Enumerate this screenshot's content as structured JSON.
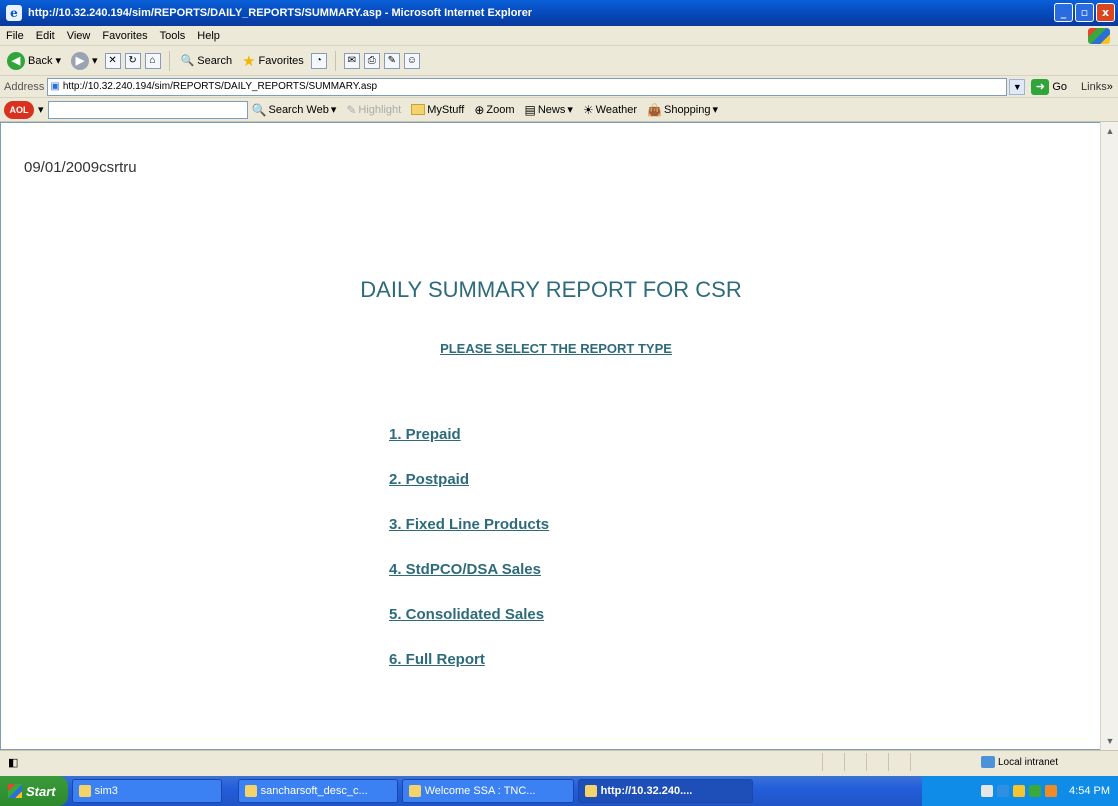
{
  "window": {
    "title": "http://10.32.240.194/sim/REPORTS/DAILY_REPORTS/SUMMARY.asp - Microsoft Internet Explorer",
    "minimize": "_",
    "maximize": "▫",
    "close": "x"
  },
  "menu": [
    "File",
    "Edit",
    "View",
    "Favorites",
    "Tools",
    "Help"
  ],
  "toolbar": {
    "back": "Back",
    "search": "Search",
    "favorites": "Favorites"
  },
  "address": {
    "label": "Address",
    "url": "http://10.32.240.194/sim/REPORTS/DAILY_REPORTS/SUMMARY.asp",
    "go": "Go",
    "links": "Links"
  },
  "search_toolbar": {
    "search_web": "Search Web",
    "highlight": "Highlight",
    "mystuff": "MyStuff",
    "zoom": "Zoom",
    "news": "News",
    "weather": "Weather",
    "shopping": "Shopping"
  },
  "page": {
    "user_line": "09/01/2009csrtru",
    "title": "DAILY SUMMARY REPORT FOR CSR",
    "subtitle": "PLEASE SELECT THE REPORT TYPE",
    "options": [
      "1. Prepaid",
      "2. Postpaid",
      "3. Fixed Line Products",
      "4. StdPCO/DSA Sales",
      "5. Consolidated Sales",
      "6. Full Report"
    ]
  },
  "status": {
    "zone": "Local intranet"
  },
  "taskbar": {
    "start": "Start",
    "tasks": [
      "sim3",
      "sancharsoft_desc_c...",
      "Welcome SSA : TNC...",
      "http://10.32.240...."
    ],
    "clock": "4:54 PM"
  },
  "colors": {
    "link": "#2e6b7a",
    "titlebar": "#0546b5"
  }
}
